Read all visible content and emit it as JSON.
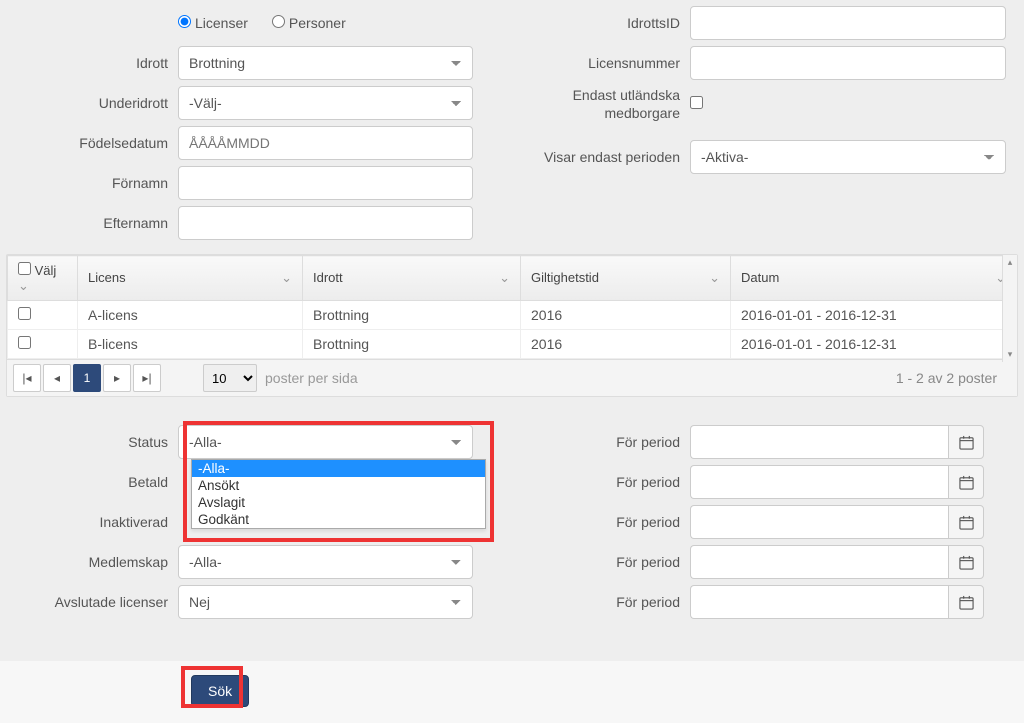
{
  "top": {
    "radio_licenser": "Licenser",
    "radio_personer": "Personer",
    "idrott_label": "Idrott",
    "idrott_value": "Brottning",
    "underidrott_label": "Underidrott",
    "underidrott_value": "-Välj-",
    "fodelsedatum_label": "Födelsedatum",
    "fodelsedatum_placeholder": "ÅÅÅÅMMDD",
    "fornamn_label": "Förnamn",
    "efternamn_label": "Efternamn",
    "idrottsid_label": "IdrottsID",
    "licensnummer_label": "Licensnummer",
    "endast_utlandska_label": "Endast utländska medborgare",
    "visar_perioden_label": "Visar endast perioden",
    "visar_perioden_value": "-Aktiva-"
  },
  "table": {
    "col_valj": "Välj",
    "col_licens": "Licens",
    "col_idrott": "Idrott",
    "col_giltighet": "Giltighetstid",
    "col_datum": "Datum",
    "rows": [
      {
        "licens": "A-licens",
        "idrott": "Brottning",
        "giltighet": "2016",
        "datum": "2016-01-01 - 2016-12-31"
      },
      {
        "licens": "B-licens",
        "idrott": "Brottning",
        "giltighet": "2016",
        "datum": "2016-01-01 - 2016-12-31"
      }
    ],
    "page_current": "1",
    "page_size": "10",
    "poster_per_sida": "poster per sida",
    "pager_info": "1 - 2 av 2 poster"
  },
  "mid": {
    "status_label": "Status",
    "status_value": "-Alla-",
    "status_options": [
      "-Alla-",
      "Ansökt",
      "Avslagit",
      "Godkänt"
    ],
    "betald_label": "Betald",
    "inaktiverad_label": "Inaktiverad",
    "medlemskap_label": "Medlemskap",
    "medlemskap_value": "-Alla-",
    "avslutade_label": "Avslutade licenser",
    "avslutade_value": "Nej",
    "for_period_label": "För period"
  },
  "footer": {
    "sok": "Sök"
  }
}
